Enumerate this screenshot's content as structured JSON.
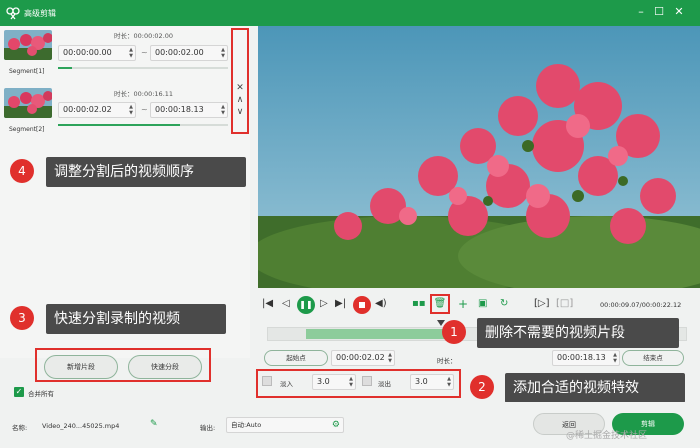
{
  "titlebar": {
    "title": "高级剪辑",
    "minimize": "–",
    "maximize": "☐",
    "close": "✕"
  },
  "segments": [
    {
      "label": "Segment[1]",
      "duration_label": "时长：00:00:02.00",
      "start": "00:00:00.00",
      "end": "00:00:02.00",
      "progress": 0.08
    },
    {
      "label": "Segment[2]",
      "duration_label": "时长：00:00:16.11",
      "start": "00:00:02.02",
      "end": "00:00:18.13",
      "progress": 0.72
    }
  ],
  "segment_side": {
    "close": "✕",
    "up": "∧",
    "down": "∨"
  },
  "callouts": {
    "c1": {
      "num": "1",
      "text": "删除不需要的视频片段"
    },
    "c2": {
      "num": "2",
      "text": "添加合适的视频特效"
    },
    "c3": {
      "num": "3",
      "text": "快速分割录制的视频"
    },
    "c4": {
      "num": "4",
      "text": "调整分割后的视频顺序"
    }
  },
  "left_buttons": {
    "new_segment": "新增片段",
    "quick_split": "快速分段"
  },
  "merge_all": "合并所有",
  "playback": {
    "time": "00:00:09.07/00:00:22.12",
    "progress": 0.26
  },
  "trim": {
    "start_button": "起始点",
    "start_value": "00:00:02.02",
    "duration_label": "时长：",
    "end_value": "00:00:18.13",
    "end_button": "结束点"
  },
  "effects": {
    "fade_in_label": "淡入",
    "fade_in_value": "3.0",
    "fade_out_label": "淡出",
    "fade_out_value": "3.0"
  },
  "bottom": {
    "name_label": "名称:",
    "file_name": "Video_240...45025.mp4",
    "output_label": "输出:",
    "output_value": "自动:Auto",
    "back_button": "返回",
    "cut_button": "剪辑"
  },
  "watermark": "@稀土掘金技术社区",
  "colors": {
    "accent": "#1d9a4a",
    "callout_red": "#e0302c"
  }
}
